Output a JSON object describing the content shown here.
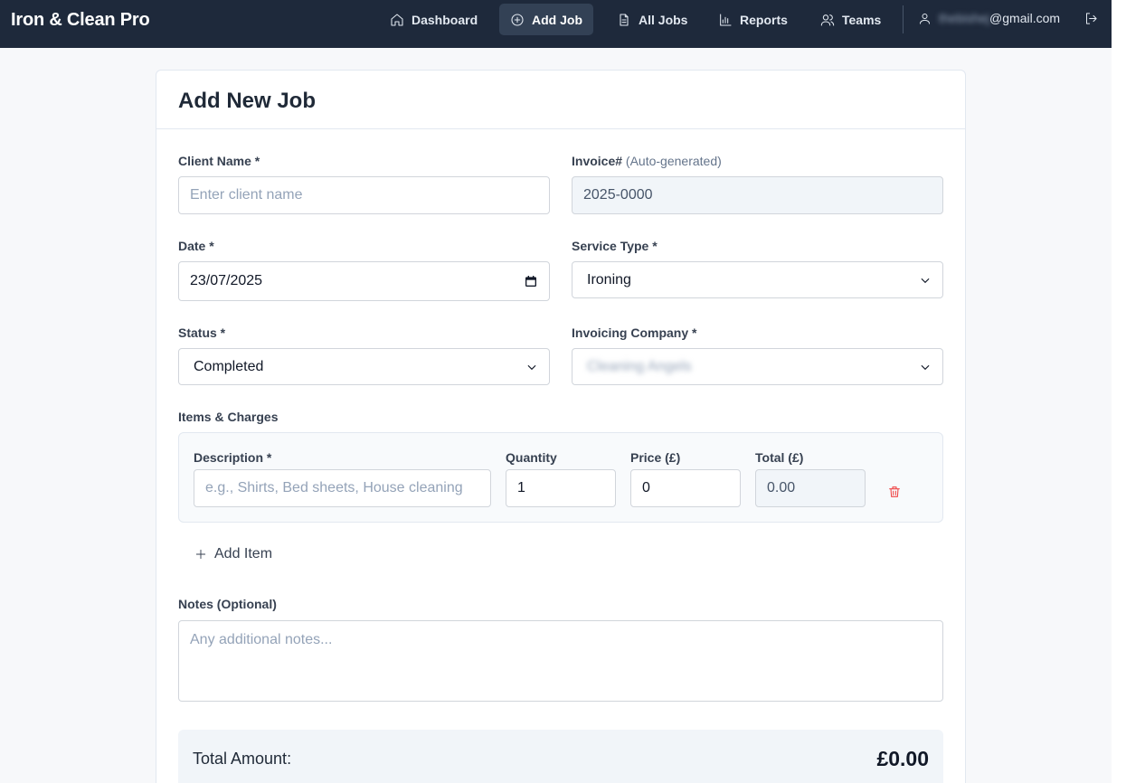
{
  "app": {
    "title": "Iron & Clean Pro"
  },
  "nav": {
    "items": [
      {
        "label": "Dashboard",
        "icon": "home-icon"
      },
      {
        "label": "Add Job",
        "icon": "plus-circle-icon",
        "active": true
      },
      {
        "label": "All Jobs",
        "icon": "file-text-icon"
      },
      {
        "label": "Reports",
        "icon": "bar-chart-icon"
      },
      {
        "label": "Teams",
        "icon": "users-icon"
      }
    ],
    "user_email_redacted": "thebishej",
    "user_email_domain": "@gmail.com"
  },
  "page": {
    "title": "Add New Job"
  },
  "form": {
    "client_name_label": "Client Name *",
    "client_name_placeholder": "Enter client name",
    "invoice_label": "Invoice#",
    "invoice_hint": "(Auto-generated)",
    "invoice_value": "2025-0000",
    "date_label": "Date *",
    "date_value": "23/07/2025",
    "service_type_label": "Service Type *",
    "service_type_value": "Ironing",
    "status_label": "Status *",
    "status_value": "Completed",
    "invoicing_company_label": "Invoicing Company *",
    "invoicing_company_value": "Cleaning Angels",
    "items_label": "Items & Charges",
    "item": {
      "description_label": "Description *",
      "description_placeholder": "e.g., Shirts, Bed sheets, House cleaning",
      "quantity_label": "Quantity",
      "quantity_value": "1",
      "price_label": "Price (£)",
      "price_value": "0",
      "total_label": "Total (£)",
      "total_value": "0.00"
    },
    "add_item_label": "Add Item",
    "notes_label": "Notes (Optional)",
    "notes_placeholder": "Any additional notes...",
    "total_amount_label": "Total Amount:",
    "total_amount_value": "£0.00"
  },
  "colors": {
    "nav_bg": "#1e293b",
    "danger": "#ef4444"
  }
}
